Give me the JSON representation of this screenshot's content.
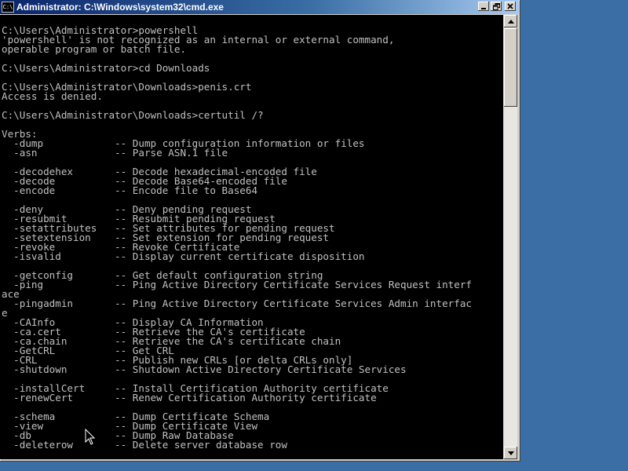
{
  "window": {
    "title": "Administrator: C:\\Windows\\system32\\cmd.exe",
    "icon_text": "C:\\"
  },
  "title_buttons": {
    "minimize": "minimize-icon",
    "maximize": "maximize-icon",
    "close": "close-icon"
  },
  "console": {
    "text_color": "#c0c0c0",
    "background_color": "#000000",
    "lines": [
      "",
      "C:\\Users\\Administrator>powershell",
      "'powershell' is not recognized as an internal or external command,",
      "operable program or batch file.",
      "",
      "C:\\Users\\Administrator>cd Downloads",
      "",
      "C:\\Users\\Administrator\\Downloads>penis.crt",
      "Access is denied.",
      "",
      "C:\\Users\\Administrator\\Downloads>certutil /?",
      "",
      "Verbs:",
      "  -dump            -- Dump configuration information or files",
      "  -asn             -- Parse ASN.1 file",
      "",
      "  -decodehex       -- Decode hexadecimal-encoded file",
      "  -decode          -- Decode Base64-encoded file",
      "  -encode          -- Encode file to Base64",
      "",
      "  -deny            -- Deny pending request",
      "  -resubmit        -- Resubmit pending request",
      "  -setattributes   -- Set attributes for pending request",
      "  -setextension    -- Set extension for pending request",
      "  -revoke          -- Revoke Certificate",
      "  -isvalid         -- Display current certificate disposition",
      "",
      "  -getconfig       -- Get default configuration string",
      "  -ping            -- Ping Active Directory Certificate Services Request interf",
      "ace",
      "  -pingadmin       -- Ping Active Directory Certificate Services Admin interfac",
      "e",
      "  -CAInfo          -- Display CA Information",
      "  -ca.cert         -- Retrieve the CA's certificate",
      "  -ca.chain        -- Retrieve the CA's certificate chain",
      "  -GetCRL          -- Get CRL",
      "  -CRL             -- Publish new CRLs [or delta CRLs only]",
      "  -shutdown        -- Shutdown Active Directory Certificate Services",
      "",
      "  -installCert     -- Install Certification Authority certificate",
      "  -renewCert       -- Renew Certification Authority certificate",
      "",
      "  -schema          -- Dump Certificate Schema",
      "  -view            -- Dump Certificate View",
      "  -db              -- Dump Raw Database",
      "  -deleterow       -- Delete server database row"
    ]
  },
  "scrollbar": {
    "up_icon": "scroll-up-arrow-icon",
    "down_icon": "scroll-down-arrow-icon"
  },
  "colors": {
    "desktop": "#3a6ea5",
    "titlebar_start": "#0a246a",
    "titlebar_end": "#a6caf0"
  }
}
